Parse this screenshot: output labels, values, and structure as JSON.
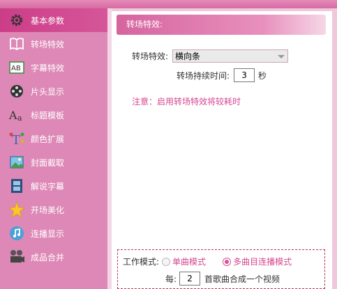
{
  "sidebar": {
    "items": [
      {
        "label": "基本参数",
        "icon": "gear-icon",
        "active": true
      },
      {
        "label": "转场特效",
        "icon": "book-icon",
        "active": false
      },
      {
        "label": "字幕特效",
        "icon": "subtitle-icon",
        "active": false
      },
      {
        "label": "片头显示",
        "icon": "film-icon",
        "active": false
      },
      {
        "label": "标题模板",
        "icon": "font-icon",
        "active": false
      },
      {
        "label": "颜色扩展",
        "icon": "color-icon",
        "active": false
      },
      {
        "label": "封面截取",
        "icon": "picture-icon",
        "active": false
      },
      {
        "label": "解说字幕",
        "icon": "film-strip-icon",
        "active": false
      },
      {
        "label": "开场美化",
        "icon": "star-icon",
        "active": false
      },
      {
        "label": "连播显示",
        "icon": "music-icon",
        "active": false
      },
      {
        "label": "成品合并",
        "icon": "projector-icon",
        "active": false
      }
    ]
  },
  "panel": {
    "title": "转场特效:",
    "effect_label": "转场特效:",
    "effect_value": "横向条",
    "duration_label": "转场持续时间:",
    "duration_value": "3",
    "duration_unit": "秒",
    "note": "注意：启用转场特效将较耗时"
  },
  "work": {
    "mode_label": "工作模式:",
    "option_single": "单曲模式",
    "option_multi": "多曲目连播模式",
    "selected": "option_multi",
    "every_label": "每:",
    "count_value": "2",
    "count_suffix": "首歌曲合成一个视频"
  },
  "colors": {
    "accent": "#d6478f",
    "sidebar": "#dd88b6",
    "active": "#cc3d88"
  }
}
